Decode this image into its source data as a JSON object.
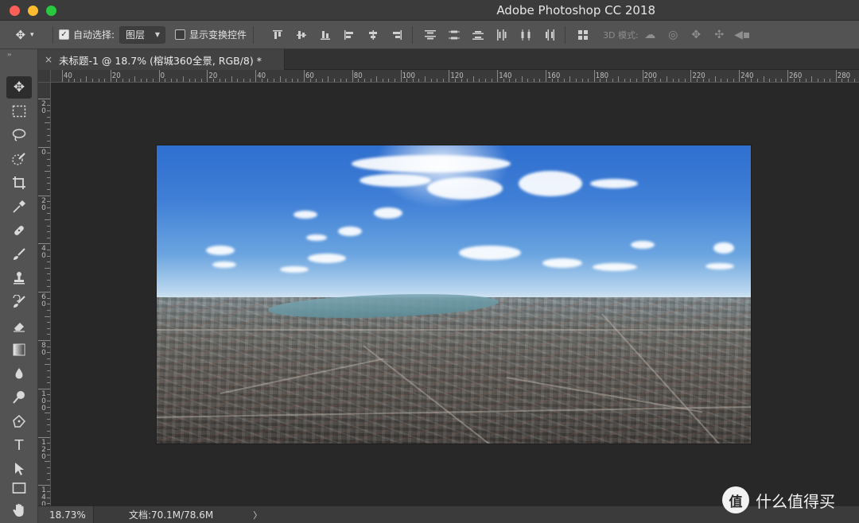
{
  "window": {
    "app_title": "Adobe Photoshop CC 2018",
    "controls": {
      "close": "close",
      "minimize": "minimize",
      "maximize": "maximize"
    }
  },
  "options_bar": {
    "move_tool_icon": "move-icon",
    "auto_select_checked": true,
    "auto_select_label": "自动选择:",
    "auto_select_target": "图层",
    "show_transform_checked": false,
    "show_transform_label": "显示变换控件",
    "mode_3d_label": "3D 模式:"
  },
  "tab": {
    "close_glyph": "×",
    "title": "未标题-1 @ 18.7% (榕城360全景, RGB/8) *"
  },
  "ruler_top": {
    "labels": [
      "40",
      "20",
      "0",
      "20",
      "40",
      "60",
      "80",
      "100",
      "120",
      "140",
      "160",
      "180",
      "200",
      "220",
      "240",
      "260",
      "280"
    ]
  },
  "ruler_left": {
    "labels": [
      "20",
      "0",
      "20",
      "40",
      "60",
      "80",
      "100",
      "120",
      "140"
    ]
  },
  "tools": [
    {
      "name": "move-tool",
      "icon": "move-icon",
      "active": true
    },
    {
      "name": "marquee-tool",
      "icon": "marquee-icon"
    },
    {
      "name": "lasso-tool",
      "icon": "lasso-icon"
    },
    {
      "name": "quick-select-tool",
      "icon": "quick-select-icon"
    },
    {
      "name": "crop-tool",
      "icon": "crop-icon"
    },
    {
      "name": "eyedropper-tool",
      "icon": "eyedropper-icon"
    },
    {
      "name": "healing-brush-tool",
      "icon": "bandage-icon"
    },
    {
      "name": "brush-tool",
      "icon": "brush-icon"
    },
    {
      "name": "clone-stamp-tool",
      "icon": "stamp-icon"
    },
    {
      "name": "history-brush-tool",
      "icon": "history-brush-icon"
    },
    {
      "name": "eraser-tool",
      "icon": "eraser-icon"
    },
    {
      "name": "gradient-tool",
      "icon": "gradient-icon"
    },
    {
      "name": "blur-tool",
      "icon": "drop-icon"
    },
    {
      "name": "dodge-tool",
      "icon": "dodge-icon"
    },
    {
      "name": "pen-tool",
      "icon": "pen-icon"
    },
    {
      "name": "type-tool",
      "icon": "type-icon",
      "glyph": "T"
    },
    {
      "name": "path-select-tool",
      "icon": "arrow-icon"
    },
    {
      "name": "rectangle-tool",
      "icon": "rectangle-icon"
    },
    {
      "name": "hand-tool",
      "icon": "hand-icon"
    }
  ],
  "status": {
    "zoom": "18.73%",
    "doc_info": "文档:70.1M/78.6M",
    "arrow": "〉"
  },
  "watermark": {
    "logo_glyph": "值",
    "text": "什么值得买"
  }
}
